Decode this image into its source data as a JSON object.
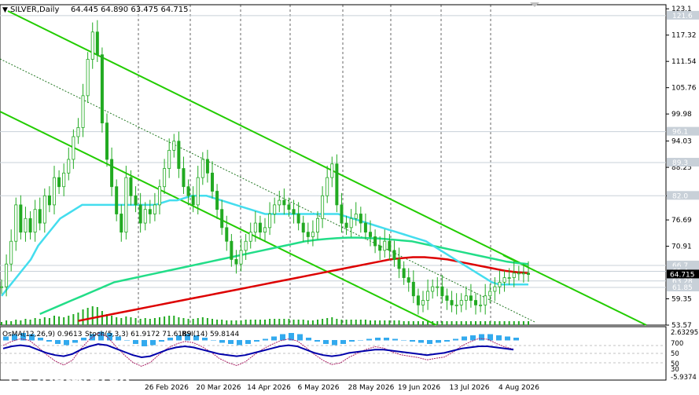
{
  "window": {
    "title": "SILVER,Daily",
    "ohlc": "64.445 64.890 63.475 64.715"
  },
  "indicators": {
    "macd_label": "OsMA(12,26,9) 0.9613",
    "stoch_label": "Stoch(5,3,3) 61.9172 71.6189",
    "rsi_label": "RSI(14) 59.8144"
  },
  "watermark": {
    "brand": "instaforex",
    "sub": "Instant Forex Trading"
  },
  "colors": {
    "ema200": "#dd0000",
    "ema144": "#22dd88",
    "ema50": "#44ddee",
    "channel": "#22cc00",
    "midline": "#227722",
    "candle": "#22aa22",
    "level_line": "#c8d0d8",
    "osma_bar": "#33aaee",
    "stoch": "#0000aa",
    "rsi": "#aa2266"
  },
  "chart_data": {
    "type": "candlestick",
    "title": "SILVER,Daily",
    "x_labels": [
      "26 Feb 2026",
      "20 Mar 2026",
      "14 Apr 2026",
      "6 May 2026",
      "28 May 2026",
      "19 Jun 2026",
      "13 Jul 2026",
      "4 Aug 2026"
    ],
    "y_ticks": [
      123.1,
      117.32,
      111.54,
      105.76,
      99.98,
      94.03,
      88.25,
      82.0,
      76.69,
      70.91,
      59.35,
      53.57
    ],
    "price_levels": [
      121.6,
      96.1,
      89.3,
      82.0,
      66.7,
      65.4,
      63.28,
      61.85
    ],
    "current_price": 64.715,
    "ylim": [
      53.57,
      124.0
    ],
    "xlim": [
      0,
      150
    ],
    "prices": [
      62,
      67,
      72,
      80,
      74,
      77,
      74,
      79,
      76,
      82,
      80,
      86,
      84,
      87,
      90,
      95,
      97,
      104,
      112,
      118,
      113,
      98,
      90,
      84,
      78,
      74,
      86,
      82,
      80,
      76,
      79,
      78,
      80,
      84,
      88,
      92,
      94,
      88,
      84,
      82,
      80,
      86,
      90,
      87,
      83,
      79,
      75,
      72,
      68,
      67,
      70,
      72,
      74,
      76,
      74,
      75,
      78,
      80,
      81,
      80,
      79,
      78,
      76,
      74,
      73,
      74,
      77,
      82,
      86,
      89,
      80,
      76,
      75,
      77,
      78,
      76,
      74,
      73,
      71,
      70,
      72,
      70,
      68,
      66,
      64,
      63,
      60,
      58,
      59,
      61,
      62,
      62,
      60,
      59,
      58,
      58,
      59,
      60,
      59,
      58,
      58,
      60,
      61,
      62,
      63,
      64,
      64,
      65,
      65,
      65,
      64.7
    ],
    "volume": [
      4,
      6,
      5,
      7,
      6,
      8,
      7,
      9,
      8,
      10,
      9,
      12,
      11,
      10,
      12,
      14,
      16,
      20,
      22,
      24,
      23,
      18,
      14,
      12,
      10,
      9,
      11,
      10,
      9,
      8,
      9,
      8,
      9,
      10,
      11,
      12,
      12,
      10,
      9,
      8,
      8,
      9,
      10,
      9,
      8,
      7,
      7,
      6,
      6,
      6,
      6,
      7,
      7,
      7,
      7,
      7,
      8,
      8,
      8,
      8,
      8,
      7,
      7,
      7,
      6,
      6,
      7,
      8,
      9,
      10,
      8,
      7,
      7,
      7,
      7,
      7,
      7,
      6,
      6,
      6,
      6,
      6,
      6,
      6,
      5,
      5,
      5,
      5,
      5,
      5,
      5,
      5,
      5,
      5,
      5,
      5,
      5,
      5,
      5,
      5,
      5,
      5,
      5,
      5,
      5,
      5,
      5,
      5,
      5,
      5,
      5
    ],
    "ema50": [
      60,
      62,
      64,
      66,
      68,
      71,
      73,
      75,
      77,
      78,
      79,
      80,
      80,
      80,
      80,
      80,
      80,
      80,
      80,
      80,
      80,
      80,
      80.5,
      81,
      81,
      81.5,
      82,
      82,
      82,
      81.5,
      81,
      80.5,
      80,
      79.5,
      79,
      78.5,
      78,
      78,
      78,
      78,
      78,
      78,
      78,
      78,
      78,
      78,
      78,
      77.5,
      77,
      76.5,
      76,
      75.5,
      75,
      74.5,
      74,
      73.5,
      73,
      72.5,
      72,
      71,
      70,
      69,
      68,
      67,
      66,
      65,
      64,
      63,
      62.5,
      62.5,
      62.5,
      62.5,
      62.5
    ],
    "ema144": [
      56,
      57,
      58,
      59,
      60,
      61,
      62,
      63,
      63.5,
      64,
      64.5,
      65,
      65.5,
      66,
      66.5,
      67,
      67.5,
      68,
      68.5,
      69,
      69.5,
      70,
      70.5,
      71,
      71.5,
      72,
      72.3,
      72.5,
      72.7,
      72.8,
      72.8,
      72.7,
      72.6,
      72.4,
      72.2,
      72,
      71.5,
      71,
      70.5,
      70,
      69.5,
      69,
      68.5,
      68,
      67.5,
      67.2,
      67
    ],
    "ema200": [
      54.5,
      55,
      55.5,
      56,
      56.5,
      57,
      57.5,
      58,
      58.5,
      59,
      59.5,
      60,
      60.5,
      61,
      61.5,
      62,
      62.5,
      63,
      63.5,
      64,
      64.5,
      65,
      65.5,
      66,
      66.5,
      67,
      67.5,
      68,
      68.3,
      68.5,
      68.5,
      68.3,
      68,
      67.5,
      67,
      66.5,
      66,
      65.5,
      65.2,
      65
    ]
  }
}
